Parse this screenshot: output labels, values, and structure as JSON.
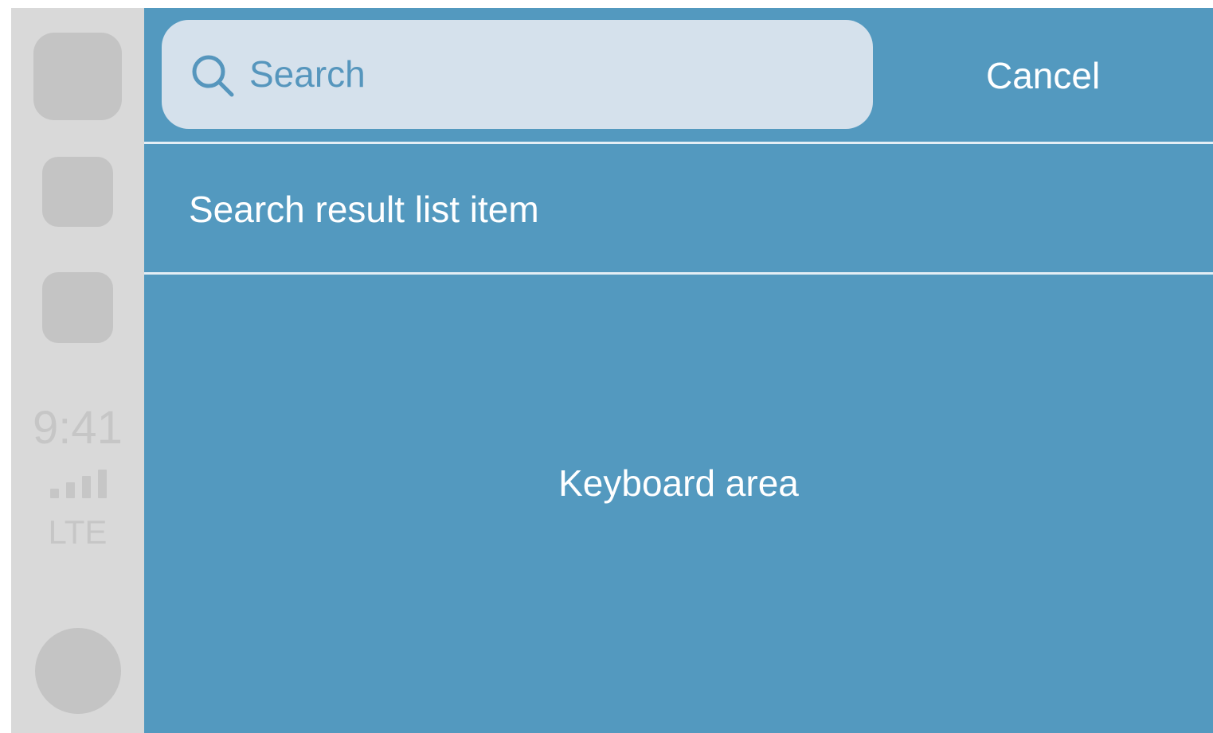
{
  "rail": {
    "time": "9:41",
    "network": "LTE",
    "signal_bars": 4
  },
  "search": {
    "placeholder": "Search",
    "value": ""
  },
  "header": {
    "cancel_label": "Cancel"
  },
  "results": [
    {
      "label": "Search result list item"
    }
  ],
  "keyboard": {
    "label": "Keyboard area"
  },
  "colors": {
    "background": "#5399bf",
    "search_field": "#d5e1ec",
    "rail": "#d9d9d9",
    "text": "#ffffff"
  }
}
